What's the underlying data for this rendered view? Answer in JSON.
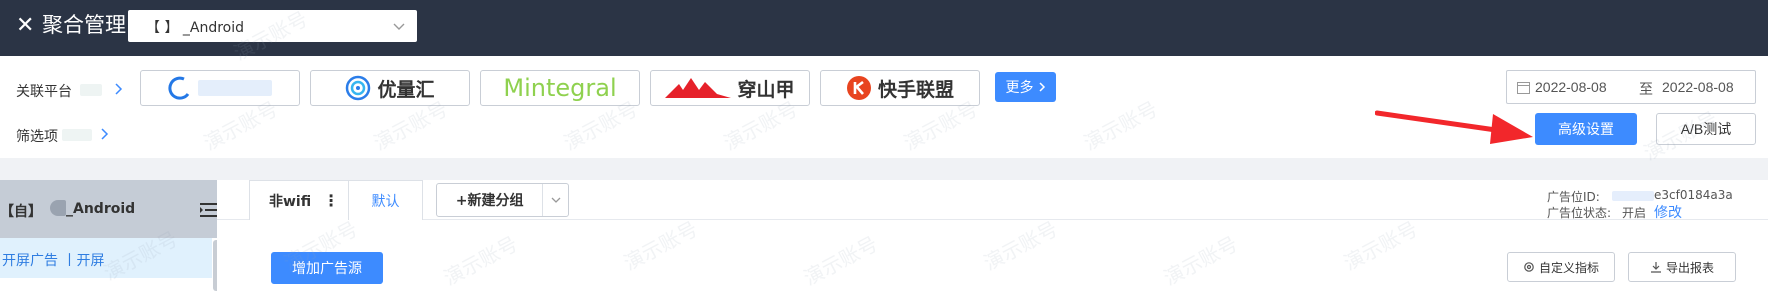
{
  "header": {
    "close_icon": "close-icon",
    "title": "聚合管理",
    "app_select_value": "【 】 _Android"
  },
  "filters": {
    "platform_label": "关联平台",
    "filter_label": "筛选项",
    "platforms": [
      {
        "name": "",
        "icon": "platform-logo-1"
      },
      {
        "name": "优量汇",
        "icon": "youlianghui-logo"
      },
      {
        "name": "Mintegral",
        "icon": "mintegral-logo"
      },
      {
        "name": "穿山甲",
        "icon": "pangle-logo"
      },
      {
        "name": "快手联盟",
        "icon": "kuaishou-logo"
      }
    ],
    "more_label": "更多",
    "date_start": "2022-08-08",
    "date_sep": "至",
    "date_end": "2022-08-08",
    "advanced_label": "高级设置",
    "ab_test_label": "A/B测试"
  },
  "sidebar": {
    "app_prefix": "【自】",
    "app_suffix": "_Android",
    "item_label": "开屏广告 丨开屏"
  },
  "main": {
    "tab_wifi": "非wifi",
    "tab_default": "默认",
    "new_group_label": "+新建分组",
    "ad_id_label": "广告位ID:",
    "ad_id_value": "e3cf0184a3a",
    "ad_status_label": "广告位状态:",
    "ad_status_value": "开启",
    "modify_label": "修改",
    "add_source_label": "增加广告源",
    "custom_metrics_label": "自定义指标",
    "export_label": "导出报表"
  },
  "watermark": "演示账号",
  "colors": {
    "topbar": "#2b3445",
    "primary": "#3d8bff",
    "arrow": "#f2272b"
  }
}
